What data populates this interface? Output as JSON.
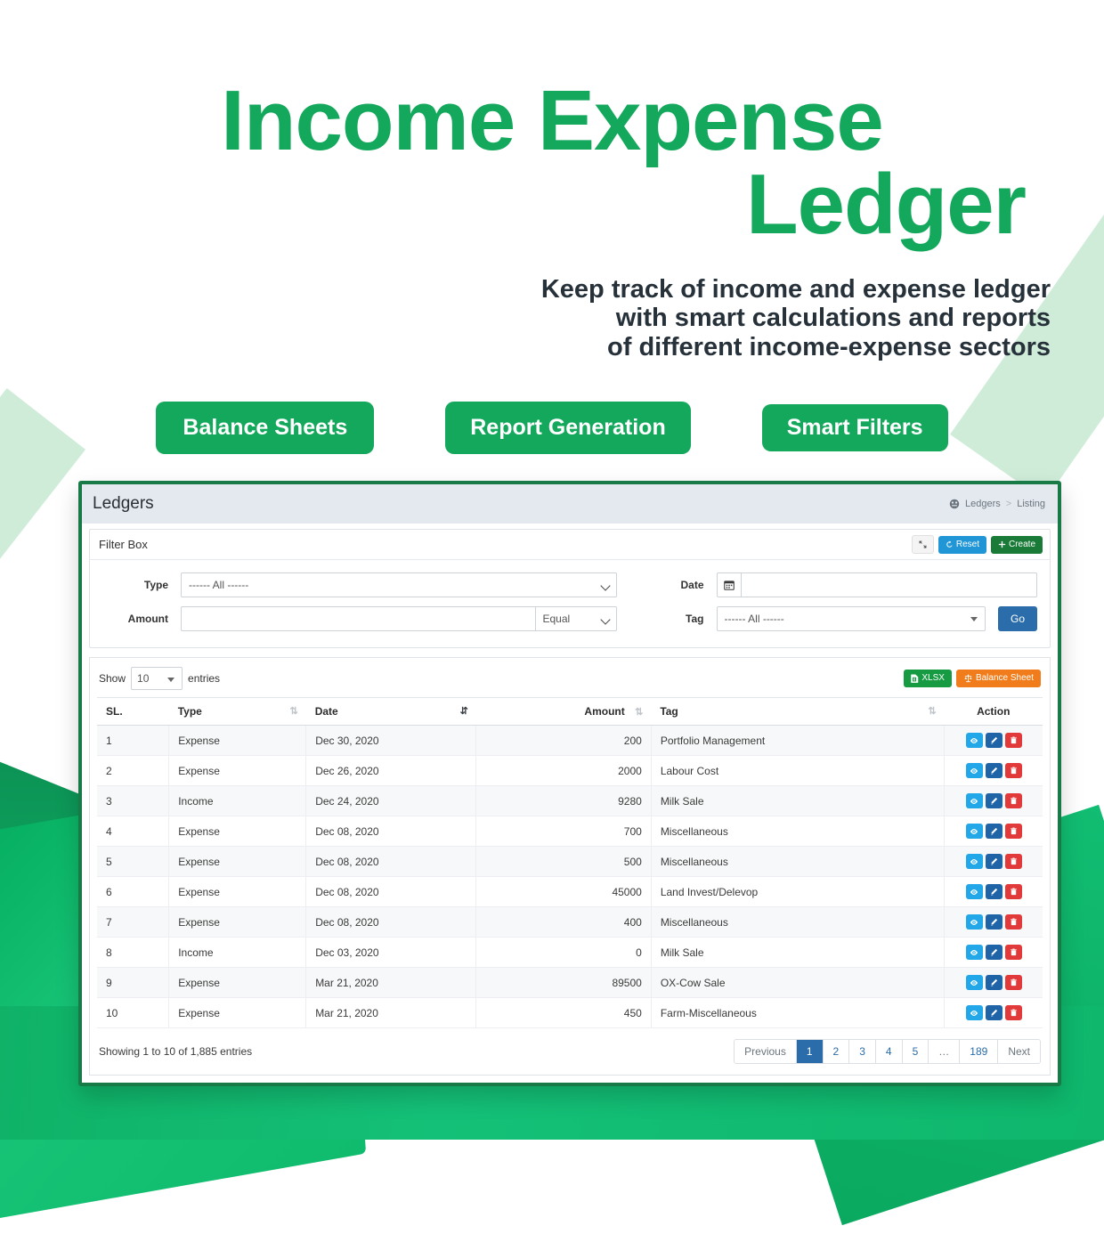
{
  "hero": {
    "title_line1": "Income Expense",
    "title_line2": "Ledger",
    "subtitle_line1": "Keep track of income and expense ledger",
    "subtitle_line2": "with smart calculations and reports",
    "subtitle_line3": "of different income-expense sectors",
    "accent_color": "#13a85c",
    "pills": [
      {
        "label": "Balance Sheets"
      },
      {
        "label": "Report Generation"
      },
      {
        "label": "Smart Filters"
      }
    ]
  },
  "app": {
    "header": {
      "title": "Ledgers",
      "breadcrumb": {
        "icon": "ledger-icon",
        "root": "Ledgers",
        "separator": ">",
        "current": "Listing"
      }
    },
    "filter_box": {
      "title": "Filter Box",
      "actions": {
        "expand_icon": "expand-arrows-icon",
        "reset_label": "Reset",
        "reset_icon": "refresh-icon",
        "create_label": "Create",
        "create_icon": "plus-icon"
      },
      "fields": {
        "type_label": "Type",
        "type_value": "------ All ------",
        "amount_label": "Amount",
        "amount_value": "",
        "amount_placeholder": "",
        "amount_operator": "Equal",
        "date_label": "Date",
        "date_value": "",
        "date_placeholder": "",
        "date_icon": "calendar-icon",
        "tag_label": "Tag",
        "tag_value": "------ All ------",
        "go_label": "Go"
      }
    },
    "table_panel": {
      "show_label": "Show",
      "entries_label": "entries",
      "page_length": "10",
      "export_buttons": [
        {
          "label": "XLSX",
          "icon": "file-excel-icon",
          "color": "#169b42"
        },
        {
          "label": "Balance Sheet",
          "icon": "balance-scale-icon",
          "color": "#f07c1b"
        }
      ],
      "columns": [
        {
          "label": "SL.",
          "sort": "none"
        },
        {
          "label": "Type",
          "sort": "both"
        },
        {
          "label": "Date",
          "sort": "desc"
        },
        {
          "label": "Amount",
          "sort": "both"
        },
        {
          "label": "Tag",
          "sort": "both"
        },
        {
          "label": "Action",
          "sort": "none"
        }
      ],
      "rows": [
        {
          "sl": "1",
          "type": "Expense",
          "date": "Dec 30, 2020",
          "amount": "200",
          "tag": "Portfolio Management"
        },
        {
          "sl": "2",
          "type": "Expense",
          "date": "Dec 26, 2020",
          "amount": "2000",
          "tag": "Labour Cost"
        },
        {
          "sl": "3",
          "type": "Income",
          "date": "Dec 24, 2020",
          "amount": "9280",
          "tag": "Milk Sale"
        },
        {
          "sl": "4",
          "type": "Expense",
          "date": "Dec 08, 2020",
          "amount": "700",
          "tag": "Miscellaneous"
        },
        {
          "sl": "5",
          "type": "Expense",
          "date": "Dec 08, 2020",
          "amount": "500",
          "tag": "Miscellaneous"
        },
        {
          "sl": "6",
          "type": "Expense",
          "date": "Dec 08, 2020",
          "amount": "45000",
          "tag": "Land Invest/Delevop"
        },
        {
          "sl": "7",
          "type": "Expense",
          "date": "Dec 08, 2020",
          "amount": "400",
          "tag": "Miscellaneous"
        },
        {
          "sl": "8",
          "type": "Income",
          "date": "Dec 03, 2020",
          "amount": "0",
          "tag": "Milk Sale"
        },
        {
          "sl": "9",
          "type": "Expense",
          "date": "Mar 21, 2020",
          "amount": "89500",
          "tag": "OX-Cow Sale"
        },
        {
          "sl": "10",
          "type": "Expense",
          "date": "Mar 21, 2020",
          "amount": "450",
          "tag": "Farm-Miscellaneous"
        }
      ],
      "row_actions": [
        {
          "name": "view",
          "icon": "eye-icon",
          "color": "#22a7e8"
        },
        {
          "name": "edit",
          "icon": "pencil-icon",
          "color": "#2064a8"
        },
        {
          "name": "delete",
          "icon": "trash-icon",
          "color": "#e23a3a"
        }
      ],
      "footer": {
        "showing_text": "Showing 1 to 10 of 1,885 entries",
        "pagination": [
          {
            "label": "Previous",
            "active": false,
            "muted": true
          },
          {
            "label": "1",
            "active": true,
            "muted": false
          },
          {
            "label": "2",
            "active": false,
            "muted": false
          },
          {
            "label": "3",
            "active": false,
            "muted": false
          },
          {
            "label": "4",
            "active": false,
            "muted": false
          },
          {
            "label": "5",
            "active": false,
            "muted": false
          },
          {
            "label": "…",
            "active": false,
            "muted": true
          },
          {
            "label": "189",
            "active": false,
            "muted": false
          },
          {
            "label": "Next",
            "active": false,
            "muted": true
          }
        ]
      }
    }
  }
}
